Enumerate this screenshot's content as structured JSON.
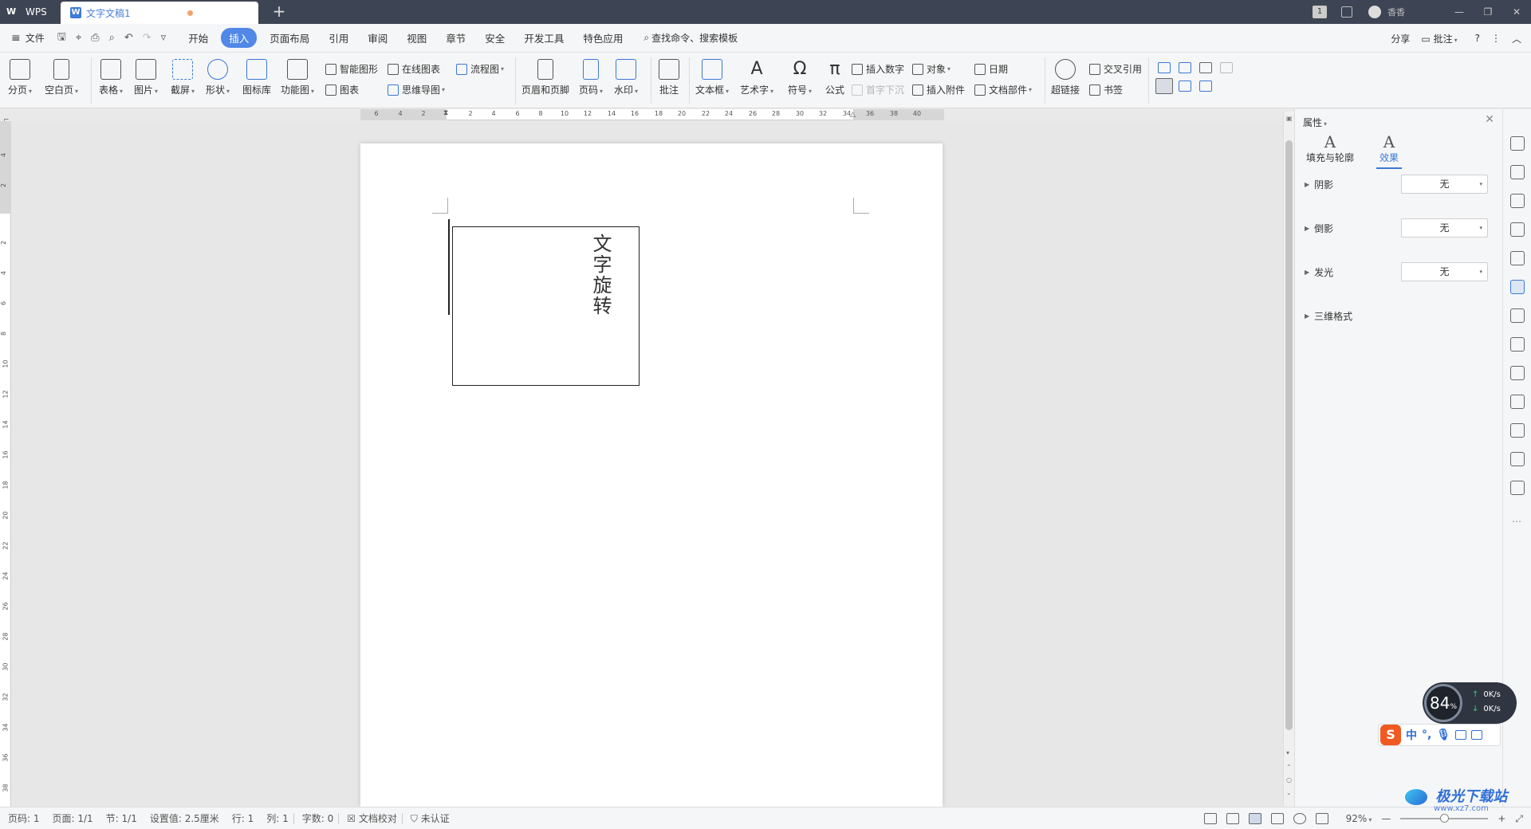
{
  "titlebar": {
    "app_label": "WPS",
    "doc_tab_label": "文字文稿1",
    "new_tab": "+",
    "user_name": "香香",
    "page_count_badge": "1"
  },
  "menubar": {
    "file": "文件",
    "tabs": [
      "开始",
      "插入",
      "页面布局",
      "引用",
      "审阅",
      "视图",
      "章节",
      "安全",
      "开发工具",
      "特色应用"
    ],
    "active_tab": "插入",
    "search": "查找命令、搜索模板",
    "share": "分享",
    "comment": "批注",
    "help": "?"
  },
  "ribbon": {
    "page_break": "分页",
    "blank_page": "空白页",
    "table": "表格",
    "picture": "图片",
    "screenshot": "截屏",
    "shape": "形状",
    "icon_lib": "图标库",
    "function_chart": "功能图",
    "smart_shape": "智能图形",
    "online_chart": "在线图表",
    "flowchart": "流程图",
    "chart": "图表",
    "mindmap": "思维导图",
    "header_footer": "页眉和页脚",
    "page_number": "页码",
    "watermark": "水印",
    "comment": "批注",
    "textbox": "文本框",
    "wordart": "艺术字",
    "symbol": "符号",
    "formula": "公式",
    "insert_number": "插入数字",
    "object": "对象",
    "date": "日期",
    "dropcap": "首字下沉",
    "attachment": "插入附件",
    "doc_parts": "文档部件",
    "hyperlink": "超链接",
    "cross_ref": "交叉引用",
    "bookmark": "书签"
  },
  "ruler": {
    "h_numbers": [
      "6",
      "4",
      "2",
      "2",
      "2",
      "4",
      "6",
      "8",
      "10",
      "12",
      "14",
      "16",
      "18",
      "20",
      "22",
      "24",
      "26",
      "28",
      "30",
      "32",
      "34",
      "36",
      "38",
      "40"
    ],
    "v_numbers": [
      "4",
      "2",
      "2",
      "4",
      "6",
      "8",
      "10",
      "12",
      "14",
      "16",
      "18",
      "20",
      "22",
      "24",
      "26",
      "28",
      "30",
      "32",
      "34",
      "36",
      "38"
    ]
  },
  "document": {
    "textbox_text": "文字旋转"
  },
  "panel": {
    "title": "属性",
    "tab_fill": "填充与轮廓",
    "tab_effect": "效果",
    "rows": [
      {
        "label": "阴影",
        "value": "无"
      },
      {
        "label": "倒影",
        "value": "无"
      },
      {
        "label": "发光",
        "value": "无"
      },
      {
        "label": "三维格式",
        "value": ""
      }
    ]
  },
  "status": {
    "page_no": "页码: 1",
    "pages": "页面: 1/1",
    "section": "节: 1/1",
    "setting": "设置值: 2.5厘米",
    "row": "行: 1",
    "col": "列: 1",
    "words": "字数: 0",
    "proofread": "文档校对",
    "auth": "未认证",
    "zoom": "92%"
  },
  "widgets": {
    "net_percent": "84",
    "net_percent_unit": "%",
    "upload": "0K/s",
    "download": "0K/s",
    "ime_lang": "中",
    "site_name": "极光下载站",
    "site_url": "www.xz7.com"
  }
}
